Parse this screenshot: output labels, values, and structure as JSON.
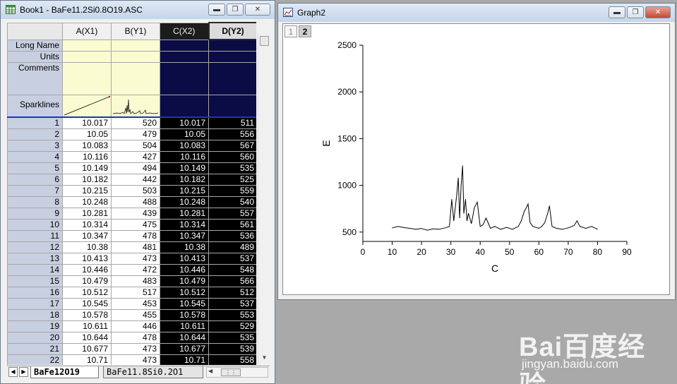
{
  "colors": {
    "accent": "#2034b8",
    "selected_column_bg": "#000000",
    "metadata_bg": "#fbfbd2",
    "row_header_bg": "#c8cfe0"
  },
  "book": {
    "title": "Book1 - BaFe11.2Si0.8O19.ASC",
    "icon": "worksheet-icon",
    "buttons": {
      "minimize": "minimize-icon",
      "restore": "restore-icon",
      "close": "close-icon"
    },
    "columns": [
      "A(X1)",
      "B(Y1)",
      "C(X2)",
      "D(Y2)"
    ],
    "meta_labels": [
      "Long Name",
      "Units",
      "Comments",
      "Sparklines"
    ],
    "rows": [
      {
        "n": "1",
        "a": "10.017",
        "b": "520",
        "c": "10.017",
        "d": "511"
      },
      {
        "n": "2",
        "a": "10.05",
        "b": "479",
        "c": "10.05",
        "d": "556"
      },
      {
        "n": "3",
        "a": "10.083",
        "b": "504",
        "c": "10.083",
        "d": "567"
      },
      {
        "n": "4",
        "a": "10.116",
        "b": "427",
        "c": "10.116",
        "d": "560"
      },
      {
        "n": "5",
        "a": "10.149",
        "b": "494",
        "c": "10.149",
        "d": "535"
      },
      {
        "n": "6",
        "a": "10.182",
        "b": "442",
        "c": "10.182",
        "d": "525"
      },
      {
        "n": "7",
        "a": "10.215",
        "b": "503",
        "c": "10.215",
        "d": "559"
      },
      {
        "n": "8",
        "a": "10.248",
        "b": "488",
        "c": "10.248",
        "d": "540"
      },
      {
        "n": "9",
        "a": "10.281",
        "b": "439",
        "c": "10.281",
        "d": "557"
      },
      {
        "n": "10",
        "a": "10.314",
        "b": "475",
        "c": "10.314",
        "d": "561"
      },
      {
        "n": "11",
        "a": "10.347",
        "b": "478",
        "c": "10.347",
        "d": "536"
      },
      {
        "n": "12",
        "a": "10.38",
        "b": "481",
        "c": "10.38",
        "d": "489"
      },
      {
        "n": "13",
        "a": "10.413",
        "b": "473",
        "c": "10.413",
        "d": "537"
      },
      {
        "n": "14",
        "a": "10.446",
        "b": "472",
        "c": "10.446",
        "d": "548"
      },
      {
        "n": "15",
        "a": "10.479",
        "b": "483",
        "c": "10.479",
        "d": "566"
      },
      {
        "n": "16",
        "a": "10.512",
        "b": "517",
        "c": "10.512",
        "d": "512"
      },
      {
        "n": "17",
        "a": "10.545",
        "b": "453",
        "c": "10.545",
        "d": "537"
      },
      {
        "n": "18",
        "a": "10.578",
        "b": "455",
        "c": "10.578",
        "d": "553"
      },
      {
        "n": "19",
        "a": "10.611",
        "b": "446",
        "c": "10.611",
        "d": "529"
      },
      {
        "n": "20",
        "a": "10.644",
        "b": "478",
        "c": "10.644",
        "d": "535"
      },
      {
        "n": "21",
        "a": "10.677",
        "b": "473",
        "c": "10.677",
        "d": "539"
      },
      {
        "n": "22",
        "a": "10.71",
        "b": "473",
        "c": "10.71",
        "d": "558"
      }
    ],
    "sheet_tabs": [
      "BaFe12O19",
      "BaFe11.8Si0.2O1"
    ]
  },
  "graph": {
    "title": "Graph2",
    "icon": "graph-icon",
    "buttons": {
      "minimize": "minimize-icon",
      "restore": "restore-icon",
      "close": "close-icon"
    },
    "layers": [
      "1",
      "2"
    ]
  },
  "chart_data": {
    "type": "line",
    "title": "",
    "xlabel": "C",
    "ylabel": "E",
    "xlim": [
      0,
      90
    ],
    "ylim": [
      400,
      2500
    ],
    "xticks": [
      0,
      10,
      20,
      30,
      40,
      50,
      60,
      70,
      80,
      90
    ],
    "yticks": [
      500,
      1000,
      1500,
      2000,
      2500
    ],
    "grid": false,
    "series": [
      {
        "color": "#000000",
        "x": [
          10,
          12,
          14,
          16,
          18,
          20,
          22,
          24,
          26,
          28,
          29.5,
          30.3,
          31,
          32,
          32.5,
          33,
          33.5,
          34,
          34.4,
          35,
          35.5,
          36,
          37,
          38,
          39,
          40,
          41,
          42,
          42.7,
          43.5,
          45,
          47,
          49,
          51,
          53,
          54,
          55,
          55.7,
          56.3,
          57,
          58,
          60,
          61,
          62,
          63,
          63.6,
          64.5,
          66,
          68,
          70,
          72,
          73,
          74,
          76,
          78,
          80
        ],
        "y": [
          545,
          560,
          548,
          540,
          530,
          538,
          520,
          535,
          530,
          545,
          560,
          850,
          620,
          900,
          1080,
          650,
          1000,
          1210,
          700,
          850,
          620,
          700,
          590,
          760,
          820,
          560,
          580,
          650,
          600,
          540,
          560,
          530,
          550,
          530,
          560,
          620,
          720,
          760,
          800,
          600,
          560,
          540,
          560,
          600,
          700,
          780,
          560,
          540,
          530,
          545,
          570,
          620,
          560,
          540,
          560,
          530
        ]
      }
    ]
  },
  "watermark": {
    "logo": "Bai百度经验",
    "url": "jingyan.baidu.com"
  }
}
